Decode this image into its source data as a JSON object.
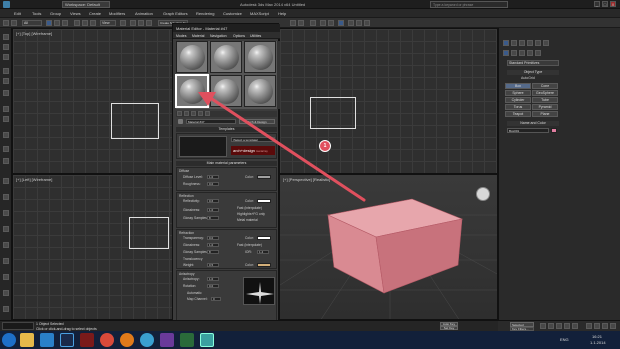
{
  "titlebar": {
    "workspace": "Workspace: Default",
    "title": "Autodesk 3ds Max 2014 x64    Untitled",
    "search_placeholder": "Type a keyword or phrase",
    "minimize": "_",
    "maximize": "□",
    "close": "X"
  },
  "menubar": {
    "items": [
      "Edit",
      "Tools",
      "Group",
      "Views",
      "Create",
      "Modifiers",
      "Animation",
      "Graph Editors",
      "Rendering",
      "Customize",
      "MAXScript",
      "Help"
    ]
  },
  "toolbar": {
    "selection_filter": "All",
    "view": "View",
    "selection_set": "Create Selection Se"
  },
  "viewports": {
    "top_label": "[+] [Top] [Wireframe]",
    "left_label": "[+] [Left] [Wireframe]",
    "perspective_label": "[+] [Perspective] [Realistic]"
  },
  "material_editor": {
    "title": "Material Editor - Material #47",
    "menu": [
      "Modes",
      "Material",
      "Navigation",
      "Options",
      "Utilities"
    ],
    "material_name": "Material #47",
    "material_type": "Arch & Design",
    "templates_label": "Templates",
    "templates_value": "(Select a template)",
    "brand": "arch+design",
    "brand_suffix": "mental ray",
    "main_params": "Main material parameters",
    "diffuse": {
      "header": "Diffuse",
      "level_label": "Diffuse Level:",
      "level": "1.0",
      "roughness_label": "Roughness:",
      "roughness": "0.0",
      "color_label": "Color:"
    },
    "reflection": {
      "header": "Reflection",
      "reflectivity_label": "Reflectivity:",
      "reflectivity": "0.6",
      "glossiness_label": "Glossiness:",
      "glossiness": "1.0",
      "samples_label": "Glossy Samples:",
      "samples": "8",
      "color_label": "Color:",
      "opt1": "Fast (interpolate)",
      "opt2": "Highlights+FG only",
      "opt3": "Metal material"
    },
    "refraction": {
      "header": "Refraction",
      "transparency_label": "Transparency:",
      "transparency": "0.0",
      "glossiness_label": "Glossiness:",
      "glossiness": "1.0",
      "samples_label": "Glossy Samples:",
      "samples": "8",
      "color_label": "Color:",
      "opt1": "Fast (interpolate)",
      "ior_label": "IOR:",
      "ior": "1.4",
      "translucency_label": "Translucency",
      "weight_label": "Weight:",
      "weight": "0.5",
      "tcolor_label": "Color:"
    },
    "anisotropy": {
      "header": "Anisotropy",
      "anisotropy_label": "Anisotropy:",
      "anisotropy": "1.0",
      "rotation_label": "Rotation:",
      "rotation": "0.0",
      "auto_label": "Automatic",
      "map_label": "Map Channel:",
      "map": "0"
    },
    "brdf": {
      "header": "BRDF",
      "ior_label": "By IOR (fresnel reflections)",
      "custom_label": "Custom Reflectivity Function",
      "zero_label": "0 deg. refl:",
      "zero": "0.2",
      "ninety_label": "90 deg. refl:",
      "ninety": "1.0",
      "curve_label": "Reflectivity vs. Angle:"
    }
  },
  "callout_number": "1",
  "command_panel": {
    "dropdown": "Standard Primitives",
    "object_type_header": "Object Type",
    "autogrid": "AutoGrid",
    "buttons": [
      "Box",
      "Cone",
      "Sphere",
      "GeoSphere",
      "Cylinder",
      "Tube",
      "Torus",
      "Pyramid",
      "Teapot",
      "Plane"
    ],
    "name_color_header": "Name and Color",
    "name": "Box001",
    "object_color": "#e07ea0"
  },
  "timeline": {
    "frame": "0 / 100"
  },
  "statusbar": {
    "selected": "1 Object Selected",
    "prompt": "Click or click-and-drag to select objects",
    "selected_dropdown": "Selected",
    "auto_key": "Auto Key",
    "set_key": "Set Key",
    "key_filters": "Key Filters..."
  },
  "taskbar": {
    "language": "ENG",
    "time": "16:21",
    "date": "1.1.2014"
  },
  "colors": {
    "accent": "#3a5a8a",
    "box": "#d98a92",
    "arrow": "#e0505e"
  }
}
